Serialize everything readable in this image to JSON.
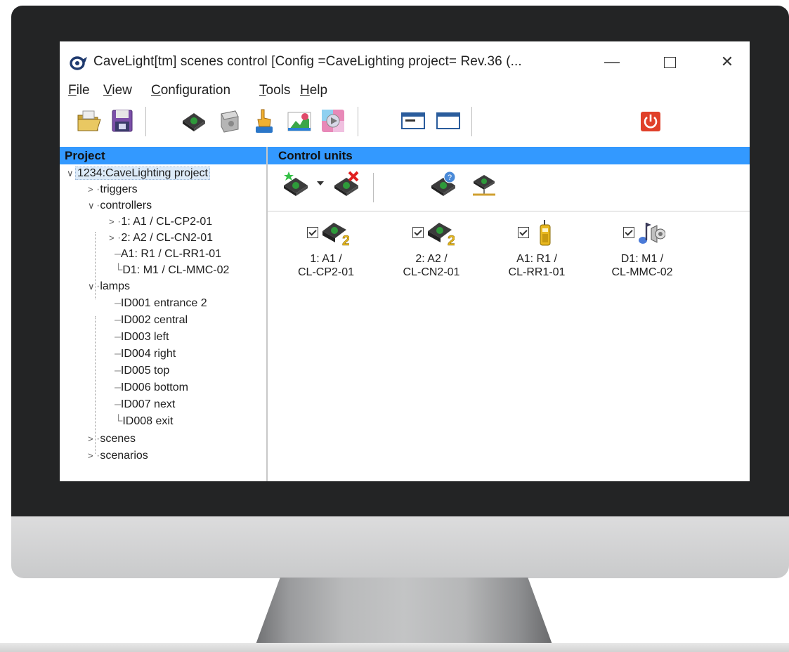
{
  "window": {
    "title": "CaveLight[tm] scenes control [Config =CaveLighting project= Rev.36 (...",
    "minimize": "—",
    "close": "✕"
  },
  "menu": [
    {
      "label": "File",
      "ul": "F",
      "rest": "ile"
    },
    {
      "label": "View",
      "ul": "V",
      "rest": "iew"
    },
    {
      "label": "Configuration",
      "ul": "C",
      "rest": "onfiguration"
    },
    {
      "label": "Tools",
      "ul": "T",
      "rest": "ools"
    },
    {
      "label": "Help",
      "ul": "H",
      "rest": "elp"
    }
  ],
  "left_panel": {
    "header": "Project",
    "root": "1234:CaveLighting project",
    "triggers": "triggers",
    "controllers": "controllers",
    "controller_items": [
      "1: A1 / CL-CP2-01",
      "2: A2 / CL-CN2-01",
      "A1: R1 / CL-RR1-01",
      "D1: M1 / CL-MMC-02"
    ],
    "lamps": "lamps",
    "lamp_items": [
      "ID001 entrance 2",
      "ID002 central",
      "ID003 left",
      "ID004 right",
      "ID005 top",
      "ID006 bottom",
      "ID007 next",
      "ID008 exit"
    ],
    "scenes": "scenes",
    "scenarios": "scenarios"
  },
  "right_panel": {
    "header": "Control units",
    "units": [
      {
        "line1": "1: A1 /",
        "line2": "CL-CP2-01",
        "icon": "controller-2-icon"
      },
      {
        "line1": "2: A2 /",
        "line2": "CL-CN2-01",
        "icon": "controller-2-icon"
      },
      {
        "line1": "A1: R1 /",
        "line2": "CL-RR1-01",
        "icon": "remote-icon"
      },
      {
        "line1": "D1: M1 /",
        "line2": "CL-MMC-02",
        "icon": "music-icon"
      }
    ]
  },
  "colors": {
    "header_blue": "#3399ff",
    "accent_red": "#e0402a",
    "device_green": "#2e9a3a"
  }
}
